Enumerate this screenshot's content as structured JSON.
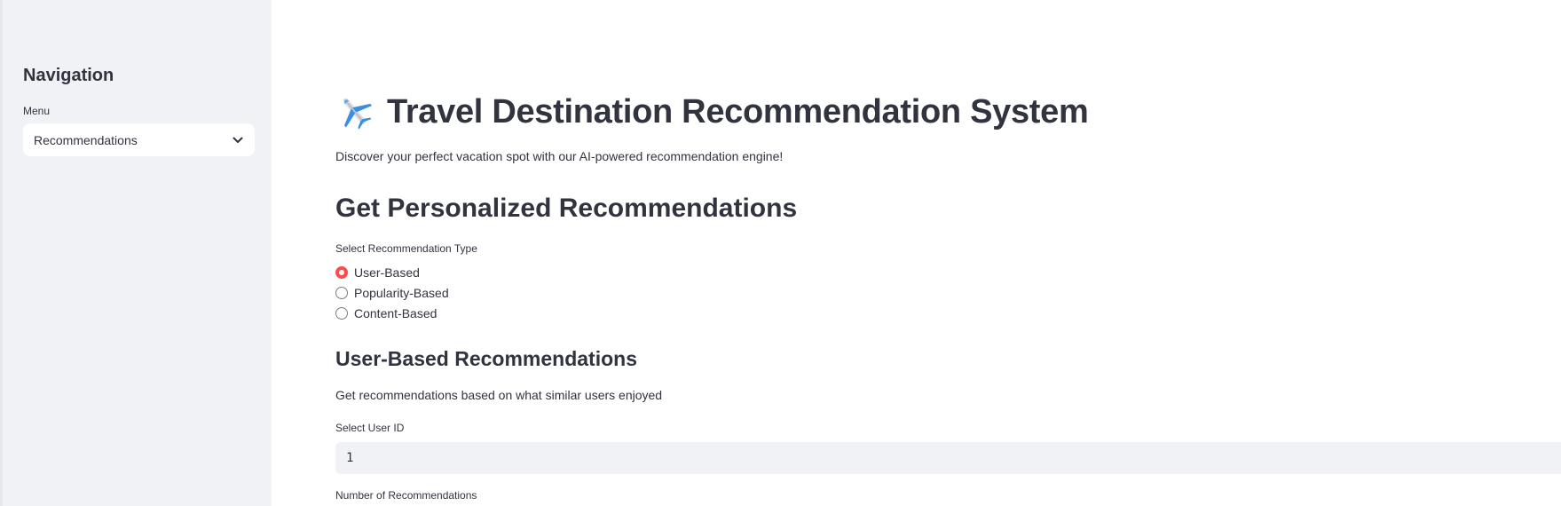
{
  "sidebar": {
    "title": "Navigation",
    "menu_label": "Menu",
    "menu_selected": "Recommendations",
    "chevron_icon": "chevron-down-icon"
  },
  "main": {
    "title": "Travel Destination Recommendation System",
    "title_icon": "airplane-icon",
    "subtitle": "Discover your perfect vacation spot with our AI-powered recommendation engine!",
    "section_title": "Get Personalized Recommendations",
    "radio_label": "Select Recommendation Type",
    "radio_options": [
      {
        "label": "User-Based",
        "checked": true
      },
      {
        "label": "Popularity-Based",
        "checked": false
      },
      {
        "label": "Content-Based",
        "checked": false
      }
    ],
    "subsection_title": "User-Based Recommendations",
    "subsection_desc": "Get recommendations based on what similar users enjoyed",
    "user_id_label": "Select User ID",
    "user_id_value": "1",
    "num_recs_label": "Number of Recommendations"
  },
  "colors": {
    "accent": "#ff4b4b",
    "sidebar_bg": "#f0f2f6",
    "text": "#31333f"
  }
}
